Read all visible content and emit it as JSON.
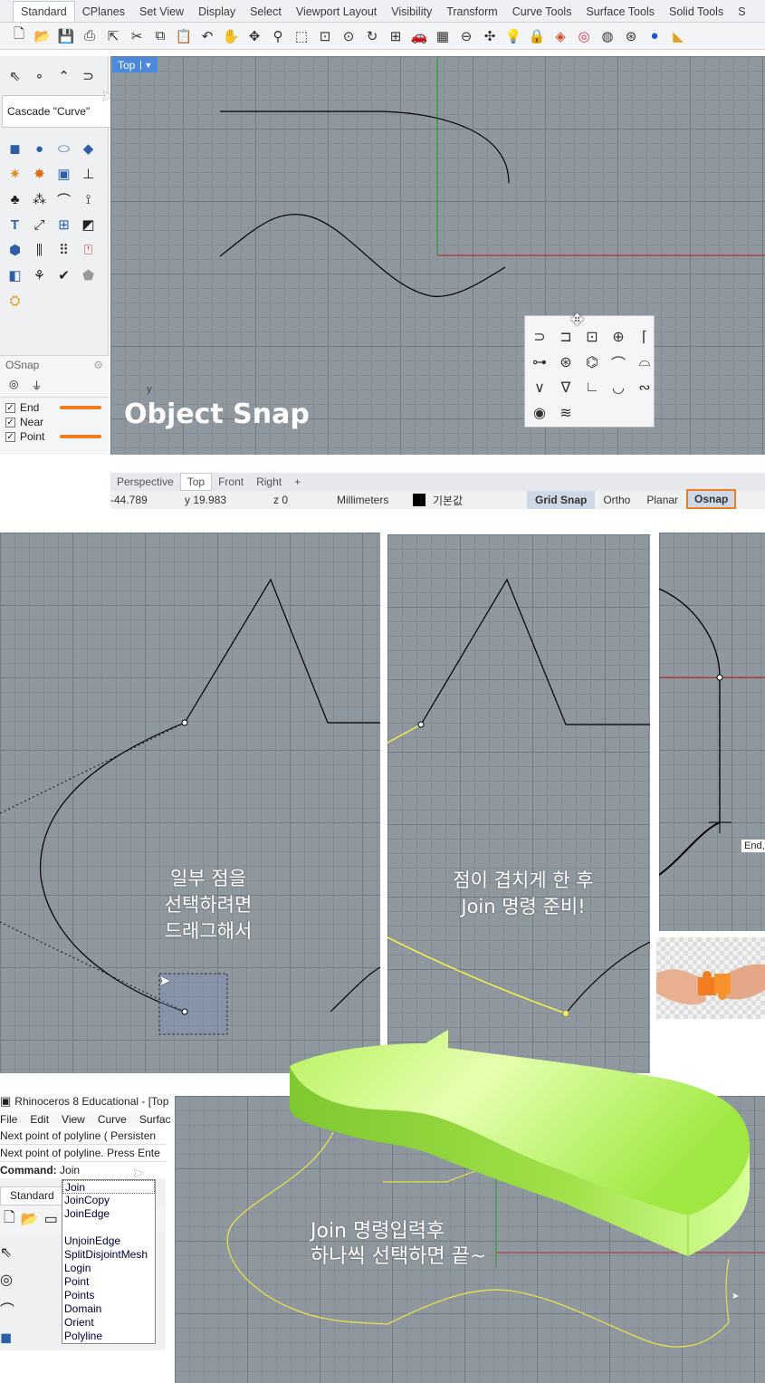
{
  "ribbon": {
    "tabs": [
      "Standard",
      "CPlanes",
      "Set View",
      "Display",
      "Select",
      "Viewport Layout",
      "Visibility",
      "Transform",
      "Curve Tools",
      "Surface Tools",
      "Solid Tools",
      "S"
    ]
  },
  "toolbar_icons": [
    "new-icon",
    "open-icon",
    "save-icon",
    "print-icon",
    "import-icon",
    "cut-icon",
    "copy-icon",
    "paste-icon",
    "undo-icon",
    "pan-icon",
    "rotate-view-icon",
    "zoom-icon",
    "zoom-window-icon",
    "zoom-extents-icon",
    "zoom-selected-icon",
    "rotate-icon",
    "four-views-icon",
    "car-icon",
    "grid-icon",
    "circle-target-icon",
    "move-icon",
    "light-icon",
    "lock-icon",
    "layer-icon",
    "color-wheel-icon",
    "sphere-icon",
    "wire-sphere-icon",
    "shaded-sphere-icon",
    "render-icon"
  ],
  "tooltip": {
    "text": "Cascade \"Curve\""
  },
  "viewport_main": {
    "title": "Top",
    "axis_label": "y"
  },
  "osnap": {
    "title": "OSnap",
    "items": [
      {
        "label": "End",
        "checked": true
      },
      {
        "label": "Near",
        "checked": true
      },
      {
        "label": "Point",
        "checked": true
      }
    ]
  },
  "overlay_title": "Object Snap",
  "viewport_tabs": [
    "Perspective",
    "Top",
    "Front",
    "Right",
    "+"
  ],
  "status": {
    "x": "-44.789",
    "y": "y 19.983",
    "z": "z 0",
    "units": "Millimeters",
    "layer": "기본값",
    "grid_snap": "Grid Snap",
    "ortho": "Ortho",
    "planar": "Planar",
    "osnap": "Osnap"
  },
  "captions": {
    "panel1": [
      "일부 점을",
      "선택하려면",
      "드래그해서"
    ],
    "panel2": [
      "점이 겹치게 한 후",
      "Join 명령 준비!"
    ],
    "panel3_tooltip": "End,",
    "panel5": [
      "Join 명령입력후",
      "하나씩 선택하면 끝~"
    ]
  },
  "rhino_window": {
    "title": "Rhinoceros 8 Educational - [Top",
    "menu": [
      "File",
      "Edit",
      "View",
      "Curve",
      "Surfac"
    ],
    "history": [
      "Next point of polyline ( Persisten",
      "Next point of polyline. Press Ente"
    ],
    "command_label": "Command:",
    "command_value": "Join",
    "tab": "Standard",
    "suggestions": [
      "Join",
      "JoinCopy",
      "JoinEdge",
      "",
      "UnjoinEdge",
      "SplitDisjointMesh",
      "Login",
      "Point",
      "Points",
      "Domain",
      "Orient",
      "Polyline"
    ]
  },
  "colors": {
    "viewport_bg": "#8f979f",
    "accent_orange": "#f47c20",
    "osnap_blue": "#4a89dc",
    "highlight_yellow": "#f4f04a",
    "solid_green": "#a6f048"
  }
}
